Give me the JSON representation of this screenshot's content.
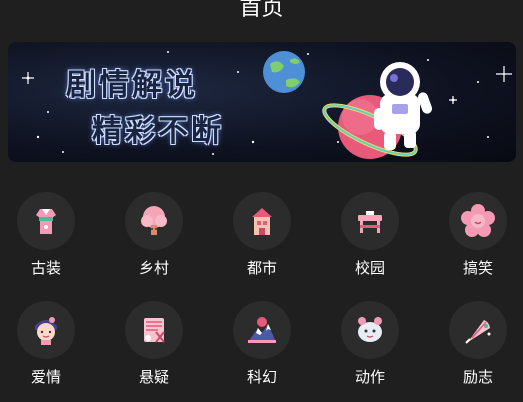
{
  "header": {
    "title": "首页"
  },
  "banner": {
    "line1": "剧情解说",
    "line2": "精彩不断"
  },
  "categories": [
    {
      "label": "古装",
      "icon": "hanfu-dress-icon"
    },
    {
      "label": "乡村",
      "icon": "village-tree-icon"
    },
    {
      "label": "都市",
      "icon": "city-building-icon"
    },
    {
      "label": "校园",
      "icon": "school-desk-icon"
    },
    {
      "label": "搞笑",
      "icon": "laughing-flower-icon"
    },
    {
      "label": "爱情",
      "icon": "love-girl-icon"
    },
    {
      "label": "悬疑",
      "icon": "mystery-scroll-icon"
    },
    {
      "label": "科幻",
      "icon": "sci-fi-mountain-icon"
    },
    {
      "label": "动作",
      "icon": "action-mascot-icon"
    },
    {
      "label": "励志",
      "icon": "inspiration-fan-icon"
    }
  ],
  "colors": {
    "background": "#1f1f1f",
    "icon_circle": "#2c2c2c",
    "accent_pink": "#f49ab4"
  }
}
